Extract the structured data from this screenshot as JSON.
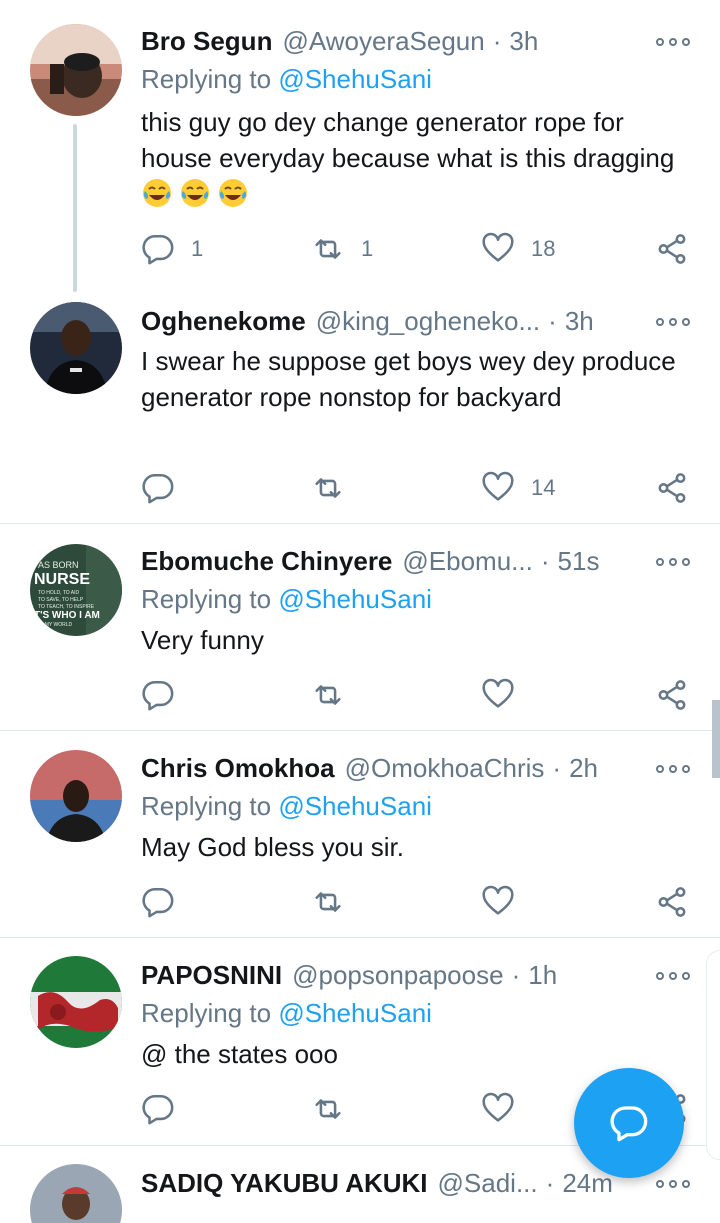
{
  "tweets": [
    {
      "name": "Bro Segun",
      "handle": "@AwoyeraSegun",
      "time": "3h",
      "replying_prefix": "Replying to",
      "replying_to": "@ShehuSani",
      "text": "this guy go dey change generator rope for house everyday because what is this dragging",
      "emoji": [
        "face-with-tears-of-joy",
        "face-with-tears-of-joy",
        "face-with-tears-of-joy"
      ],
      "replies": "1",
      "retweets": "1",
      "likes": "18"
    },
    {
      "name": "Oghenekome",
      "handle": "@king_oghenekо...",
      "time": "3h",
      "text": "I swear he suppose get boys wey dey produce generator rope nonstop for backyard",
      "replies": "",
      "retweets": "",
      "likes": "14"
    },
    {
      "name": "Ebomuche Chinyere",
      "handle": "@Ebomu...",
      "time": "51s",
      "replying_prefix": "Replying to",
      "replying_to": "@ShehuSani",
      "text": "Very funny",
      "avatar_text": [
        "AS BORN",
        "NURSE",
        "TO HOLD, TO AID",
        "TO SAVE, TO HELP",
        "TO TEACH, TO INSPIRE",
        "T'S WHO I AM",
        "& MY WORLD"
      ]
    },
    {
      "name": "Chris Omokhoa",
      "handle": "@OmokhoaChris",
      "time": "2h",
      "replying_prefix": "Replying to",
      "replying_to": "@ShehuSani",
      "text": "May God bless you sir."
    },
    {
      "name": "PAPOSNINI",
      "handle": "@popsonpapoose",
      "time": "1h",
      "replying_prefix": "Replying to",
      "replying_to": "@ShehuSani",
      "text": "@ the states ooo"
    },
    {
      "name": "SADIQ YAKUBU AKUKI",
      "handle": "@Sadi...",
      "time": "24m"
    }
  ],
  "colors": {
    "accent": "#1da1f2",
    "secondary_text": "#657786",
    "divider": "#e1e8ed"
  },
  "fab": {
    "icon": "compose-reply-icon"
  }
}
